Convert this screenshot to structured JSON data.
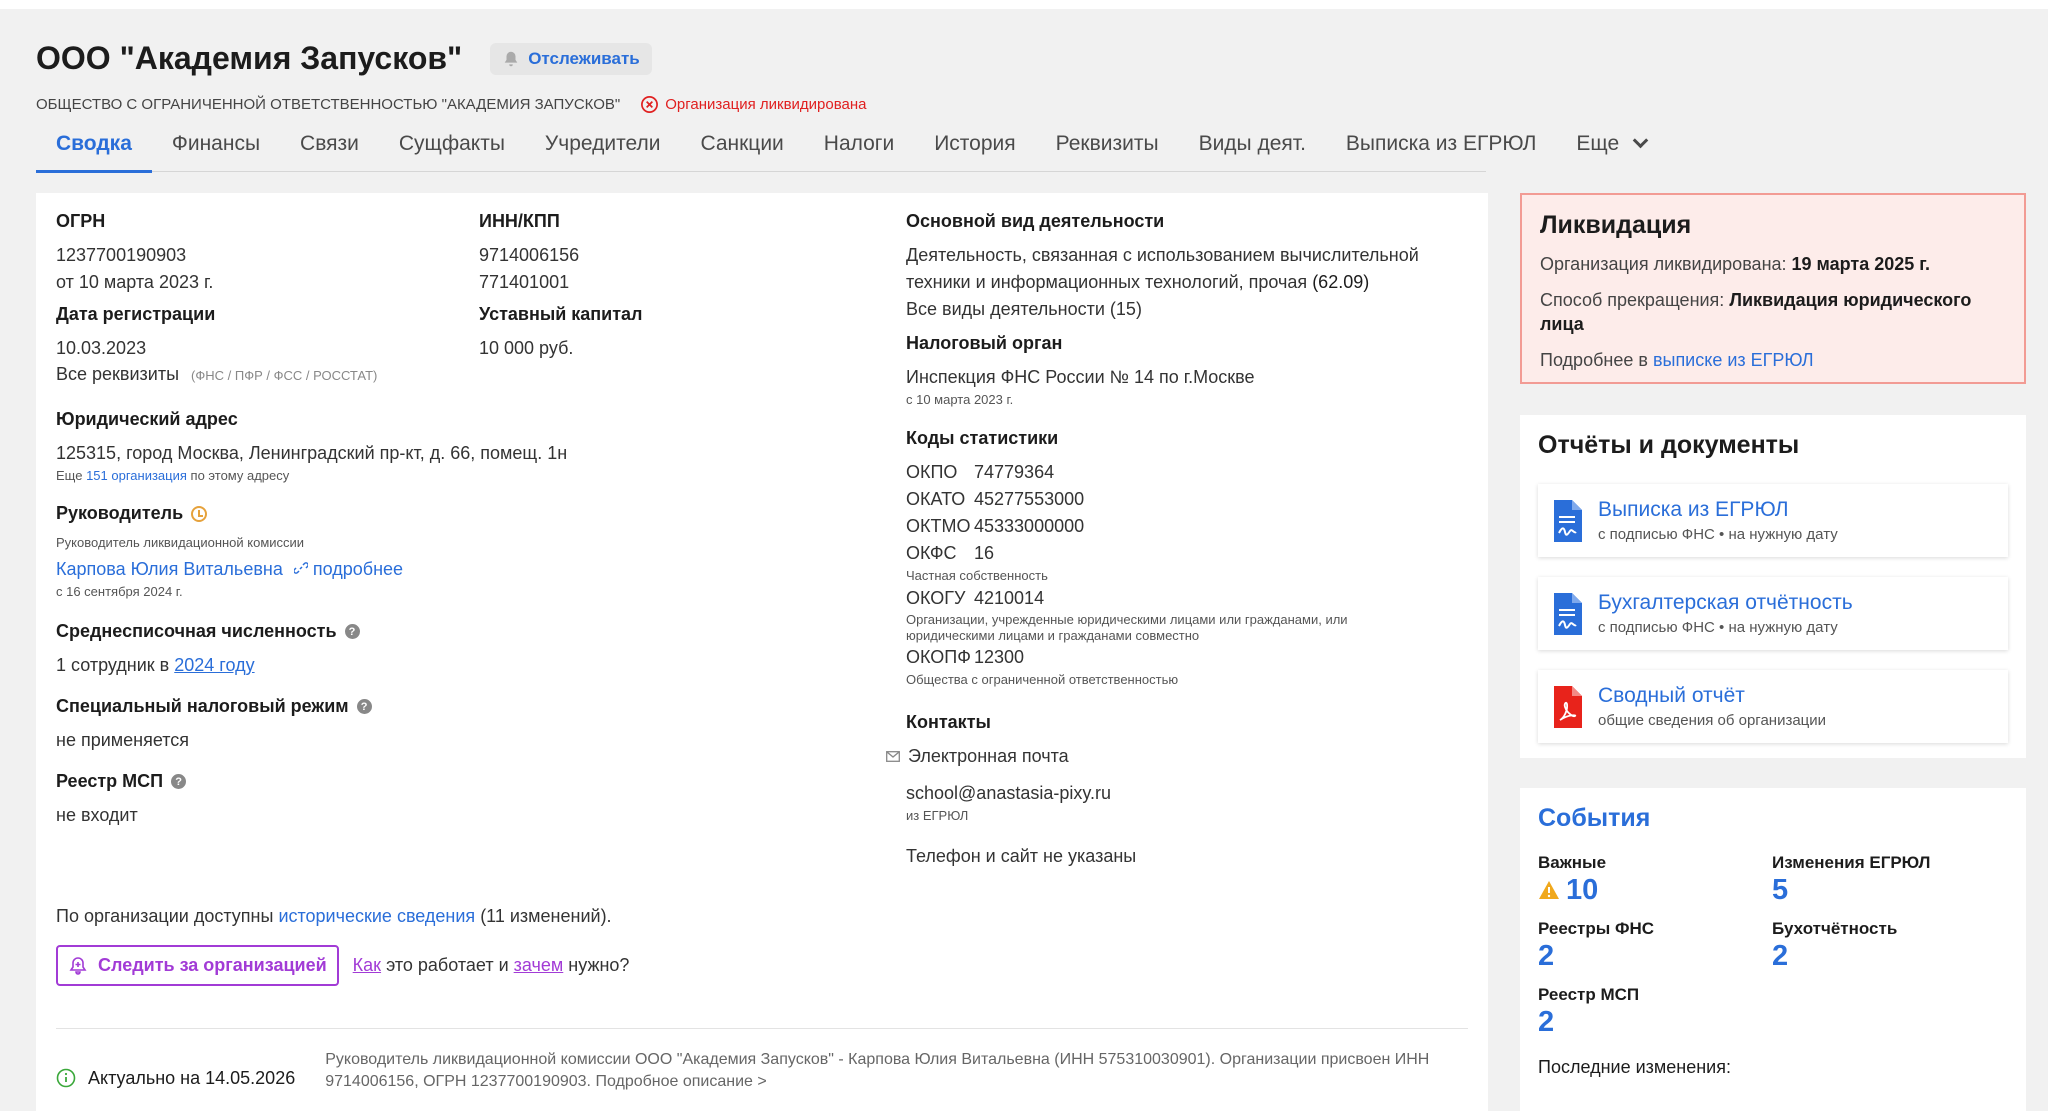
{
  "header": {
    "title": "ООО \"Академия Запусков\"",
    "follow_label": "Отслеживать",
    "full_name": "ОБЩЕСТВО С ОГРАНИЧЕННОЙ ОТВЕТСТВЕННОСТЬЮ \"АКАДЕМИЯ ЗАПУСКОВ\"",
    "status": "Организация ликвидирована"
  },
  "tabs": [
    "Сводка",
    "Финансы",
    "Связи",
    "Сущфакты",
    "Учредители",
    "Санкции",
    "Налоги",
    "История",
    "Реквизиты",
    "Виды деят.",
    "Выписка из ЕГРЮЛ",
    "Еще"
  ],
  "left": {
    "ogrn_label": "ОГРН",
    "ogrn": "1237700190903",
    "ogrn_date": "от 10 марта 2023 г.",
    "inn_label": "ИНН/КПП",
    "inn": "9714006156",
    "kpp": "771401001",
    "reg_label": "Дата регистрации",
    "reg_date": "10.03.2023",
    "capital_label": "Уставный капитал",
    "capital": "10 000 руб.",
    "all_req": "Все реквизиты",
    "all_req_note": "(ФНС / ПФР / ФСС / РОССТАТ)",
    "address_label": "Юридический адрес",
    "address": "125315, город Москва, Ленинградский пр-кт, д. 66, помещ. 1н",
    "address_more_prefix": "Еще",
    "address_more_link": "151 организация",
    "address_more_suffix": "по этому адресу",
    "head_label": "Руководитель",
    "head_role": "Руководитель ликвидационной комиссии",
    "head_name": "Карпова Юлия Витальевна",
    "head_more": "подробнее",
    "head_since": "с 16 сентября 2024 г.",
    "staff_label": "Среднесписочная численность",
    "staff_prefix": "1 сотрудник в",
    "staff_year": "2024 году",
    "tax_label": "Специальный налоговый режим",
    "tax_value": "не применяется",
    "msp_label": "Реестр МСП",
    "msp_value": "не входит",
    "history_prefix": "По организации доступны",
    "history_link": "исторические сведения",
    "history_suffix": "(11 изменений).",
    "watch_btn": "Следить за организацией",
    "how_link": "Как",
    "how_mid": "это работает и",
    "why_link": "зачем",
    "why_suffix": "нужно?"
  },
  "mid": {
    "activity_label": "Основной вид деятельности",
    "activity": "Деятельность, связанная с использованием вычислительной техники и информационных технологий, прочая",
    "activity_code": "(62.09)",
    "all_activities": "Все виды деятельности (15)",
    "tax_org_label": "Налоговый орган",
    "tax_org": "Инспекция ФНС России № 14 по г.Москве",
    "tax_org_since": "с 10 марта 2023 г.",
    "stat_label": "Коды статистики",
    "okpo_k": "ОКПО",
    "okpo_v": "74779364",
    "okato_k": "ОКАТО",
    "okato_v": "45277553000",
    "oktmo_k": "ОКТМО",
    "oktmo_v": "45333000000",
    "okfs_k": "ОКФС",
    "okfs_v": "16",
    "okfs_desc": "Частная собственность",
    "okogu_k": "ОКОГУ",
    "okogu_v": "4210014",
    "okogu_desc": "Организации, учрежденные юридическими лицами или гражданами, или юридическими лицами и гражданами совместно",
    "okopf_k": "ОКОПФ",
    "okopf_v": "12300",
    "okopf_desc": "Общества с ограниченной ответственностью",
    "contacts_label": "Контакты",
    "email_label": "Электронная почта",
    "email": "school@anastasia-pixy.ru",
    "email_source": "из ЕГРЮЛ",
    "phone": "Телефон и сайт не указаны"
  },
  "footer": {
    "actual": "Актуально на 14.05.2026",
    "text": "Руководитель ликвидационной комиссии ООО \"Академия Запусков\" - Карпова Юлия Витальевна (ИНН 575310030901). Организации присвоен ИНН 9714006156, ОГРН 1237700190903. Подробное описание >"
  },
  "liquidation": {
    "title": "Ликвидация",
    "date_label": "Организация ликвидирована:",
    "date": "19 марта 2025 г.",
    "method_label": "Способ прекращения:",
    "method": "Ликвидация юридического лица",
    "more_prefix": "Подробнее в",
    "more_link": "выписке из ЕГРЮЛ"
  },
  "docs": {
    "title": "Отчёты и документы",
    "items": [
      {
        "title": "Выписка из ЕГРЮЛ",
        "sub": "с подписью ФНС • на нужную дату"
      },
      {
        "title": "Бухгалтерская отчётность",
        "sub": "с подписью ФНС • на нужную дату"
      },
      {
        "title": "Сводный отчёт",
        "sub": "общие сведения об организации"
      }
    ]
  },
  "events": {
    "title": "События",
    "items": [
      {
        "label": "Важные",
        "value": "10"
      },
      {
        "label": "Изменения ЕГРЮЛ",
        "value": "5"
      },
      {
        "label": "Реестры ФНС",
        "value": "2"
      },
      {
        "label": "Бухотчётность",
        "value": "2"
      },
      {
        "label": "Реестр МСП",
        "value": "2"
      }
    ],
    "last_changes": "Последние изменения:"
  },
  "colors": {
    "accent": "#2a6ed9",
    "danger": "#e02020",
    "watch": "#a23bd6"
  }
}
